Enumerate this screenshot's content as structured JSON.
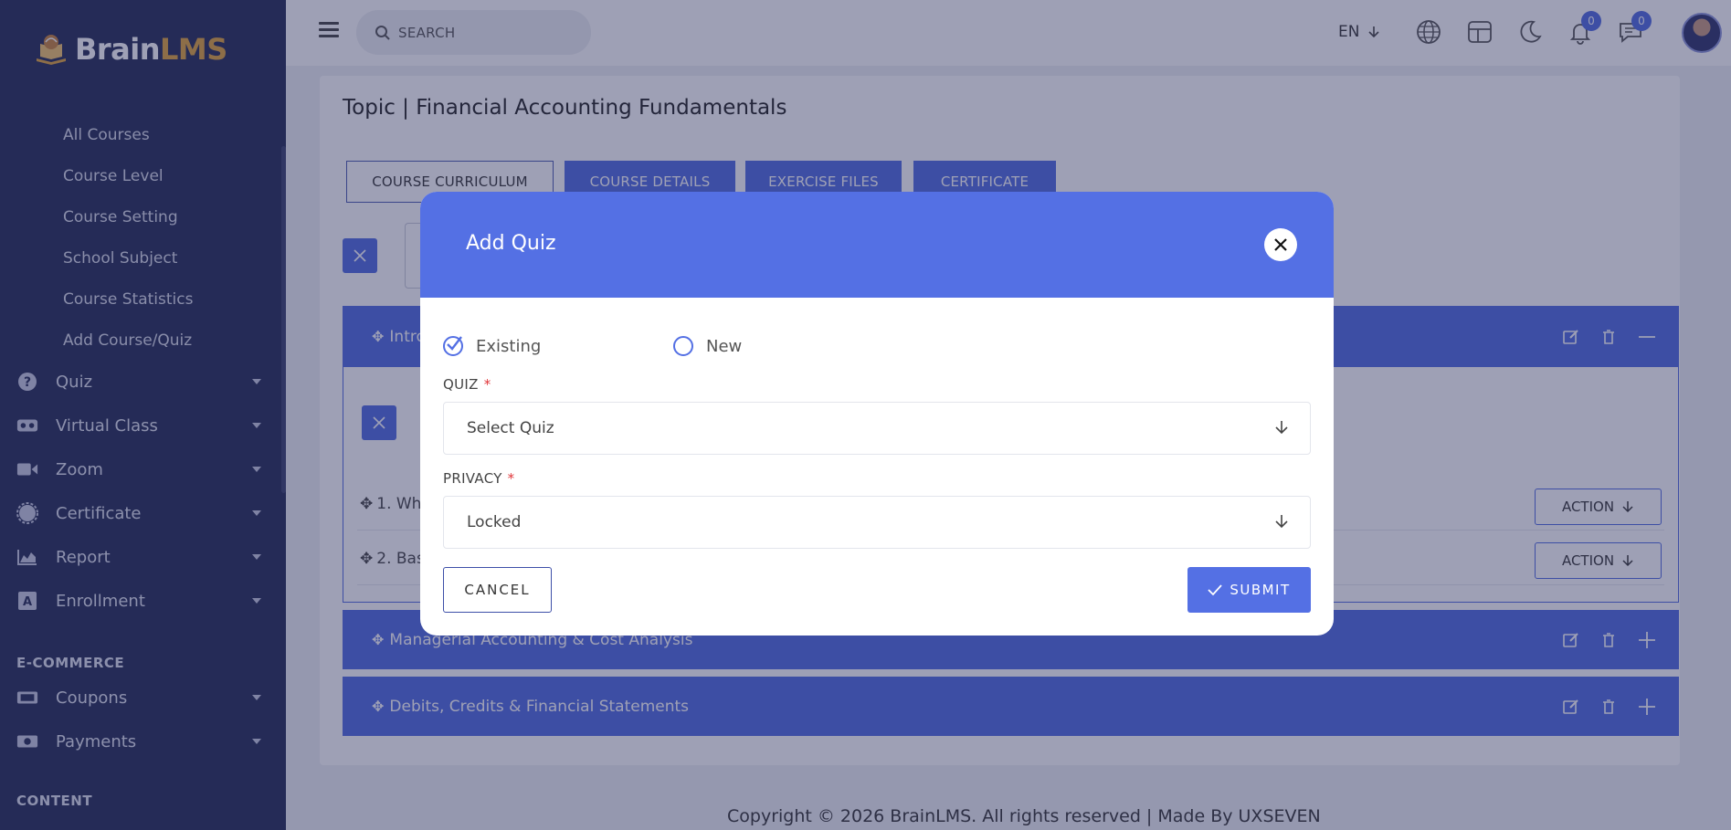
{
  "app": {
    "logo_main": "Brain",
    "logo_accent": "LMS"
  },
  "sidebar": {
    "sub_items": [
      {
        "label": "All Courses"
      },
      {
        "label": "Course Level"
      },
      {
        "label": "Course Setting"
      },
      {
        "label": "School Subject"
      },
      {
        "label": "Course Statistics"
      },
      {
        "label": "Add Course/Quiz"
      }
    ],
    "menu": [
      {
        "label": "Quiz",
        "icon": "question-circle-icon"
      },
      {
        "label": "Virtual Class",
        "icon": "vr-headset-icon"
      },
      {
        "label": "Zoom",
        "icon": "video-camera-icon"
      },
      {
        "label": "Certificate",
        "icon": "certificate-icon"
      },
      {
        "label": "Report",
        "icon": "chart-area-icon"
      },
      {
        "label": "Enrollment",
        "icon": "enrollment-icon"
      }
    ],
    "section_ecommerce": "E-COMMERCE",
    "ecommerce": [
      {
        "label": "Coupons",
        "icon": "ticket-icon"
      },
      {
        "label": "Payments",
        "icon": "money-icon"
      }
    ],
    "section_content": "CONTENT"
  },
  "topbar": {
    "search_placeholder": "SEARCH",
    "language": "EN",
    "notifications_count": "0",
    "messages_count": "0"
  },
  "page": {
    "title": "Topic | Financial Accounting Fundamentals",
    "tabs": [
      {
        "label": "COURSE CURRICULUM"
      },
      {
        "label": "COURSE DETAILS"
      },
      {
        "label": "EXERCISE FILES"
      },
      {
        "label": "CERTIFICATE"
      }
    ],
    "sections": [
      {
        "title": "Intro"
      },
      {
        "title": "Managerial Accounting & Cost Analysis"
      },
      {
        "title": "Debits, Credits & Financial Statements"
      }
    ],
    "lessons": [
      {
        "title": "1. Wha"
      },
      {
        "title": "2. Bas"
      }
    ],
    "action_label": "ACTION",
    "footer": "Copyright © 2026 BrainLMS. All rights reserved | Made By UXSEVEN"
  },
  "modal": {
    "title": "Add Quiz",
    "option_existing": "Existing",
    "option_new": "New",
    "selected_option": "Existing",
    "quiz_label": "QUIZ",
    "quiz_value": "Select Quiz",
    "privacy_label": "PRIVACY",
    "privacy_value": "Locked",
    "cancel_label": "CANCEL",
    "submit_label": "SUBMIT",
    "required_marker": "*"
  },
  "colors": {
    "sidebar_bg": "#232a54",
    "accent": "#4f6ae0",
    "modal_header": "#5470e4",
    "logo_accent": "#e0a43a",
    "required": "#e0363a"
  }
}
